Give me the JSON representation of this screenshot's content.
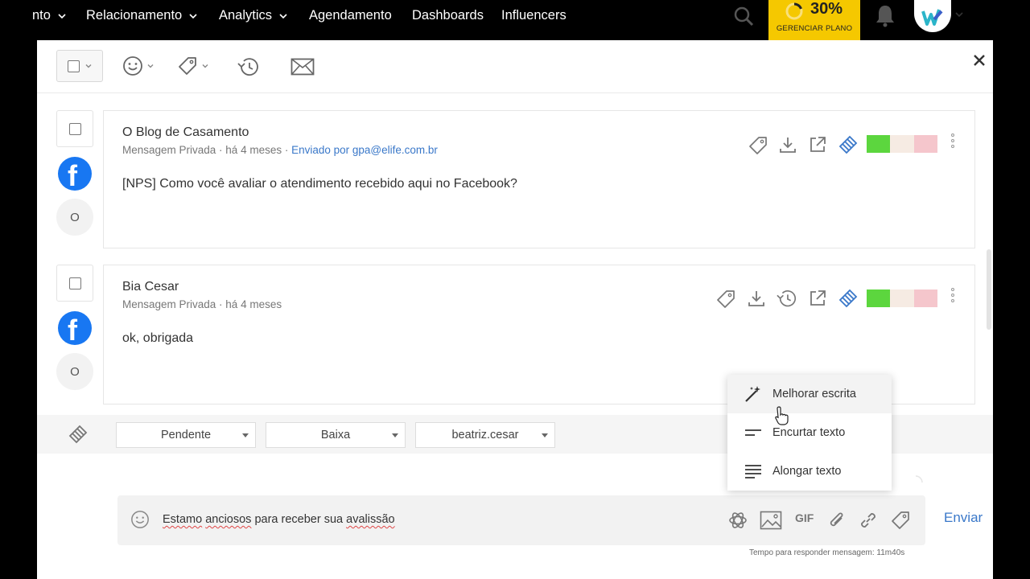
{
  "nav": {
    "items": [
      "nto",
      "Relacionamento",
      "Analytics",
      "Agendamento",
      "Dashboards",
      "Influencers"
    ],
    "plan_percent": "30%",
    "plan_label": "GERENCIAR PLANO",
    "plan_color": "#f5c800"
  },
  "messages": [
    {
      "name": "O Blog de Casamento",
      "meta": "Mensagem Privada · há 4 meses ·",
      "sent_by": "Enviado por gpa@elife.com.br",
      "body": "[NPS] Como você avaliar o atendimento recebido aqui no Facebook?",
      "avatar_letter": "O",
      "network_icon": "facebook-icon"
    },
    {
      "name": "Bia Cesar",
      "meta": "Mensagem Privada · há 4 meses",
      "body": "ok, obrigada",
      "avatar_letter": "O",
      "network_icon": "facebook-icon"
    }
  ],
  "status_bar": {
    "status": "Pendente",
    "priority": "Baixa",
    "assignee": "beatriz.cesar"
  },
  "ai_menu": {
    "items": [
      "Melhorar escrita",
      "Encurtar texto",
      "Alongar texto"
    ]
  },
  "compose": {
    "text_parts": [
      "Estamo",
      " ",
      "anciosos",
      " para receber sua ",
      "avalissão"
    ],
    "gif_label": "GIF",
    "send_label": "Enviar",
    "timer": "Tempo para responder mensagem: 11m40s"
  },
  "colors": {
    "sentiment_positive": "#5cd63e",
    "sentiment_neutral": "#f6ebe3",
    "sentiment_negative": "#f5c6cc",
    "accent": "#3a78c9"
  }
}
